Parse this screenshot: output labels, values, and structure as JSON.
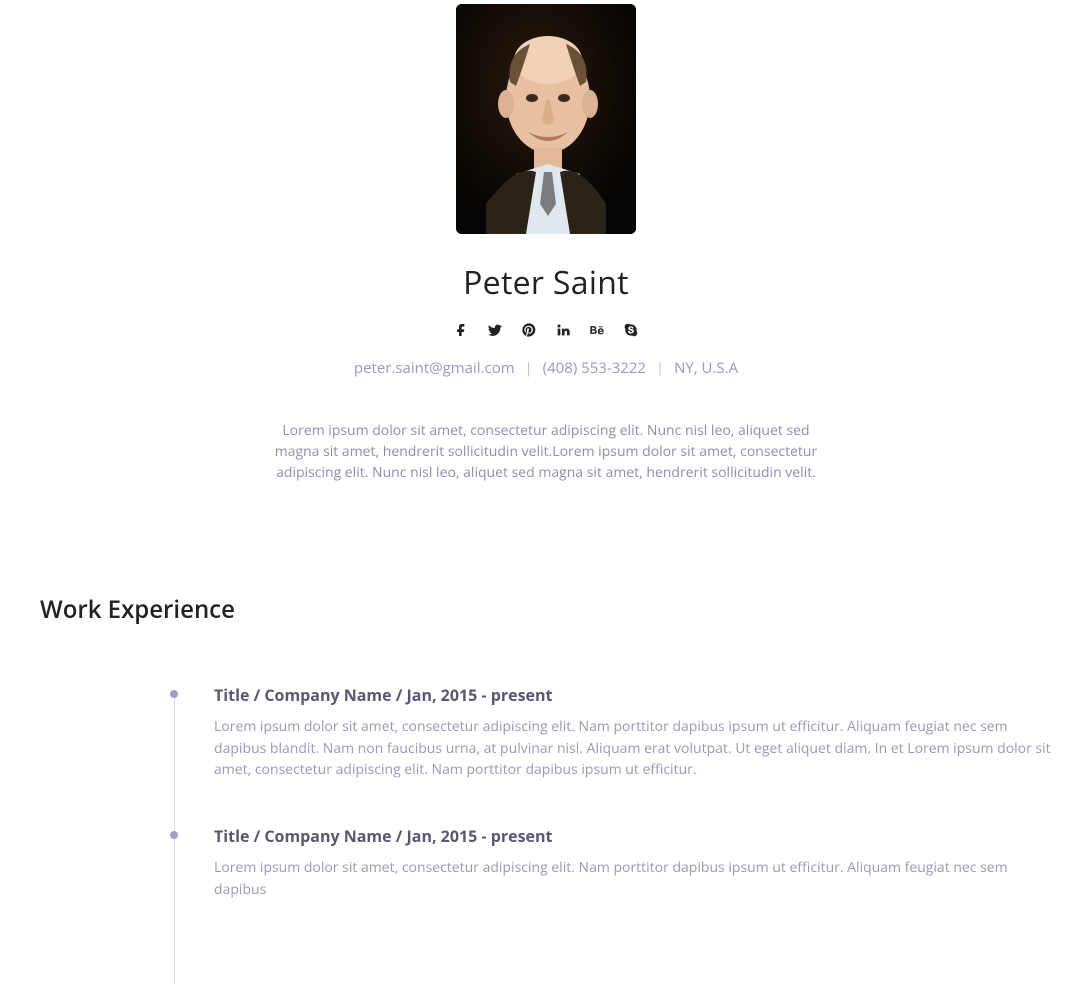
{
  "header": {
    "name": "Peter Saint",
    "email": "peter.saint@gmail.com",
    "phone": "(408) 553-3222",
    "location": "NY, U.S.A",
    "bio": "Lorem ipsum dolor sit amet, consectetur adipiscing elit. Nunc nisl leo, aliquet sed magna sit amet, hendrerit sollicitudin velit.Lorem ipsum dolor sit amet, consectetur adipiscing elit. Nunc nisl leo, aliquet sed magna sit amet, hendrerit sollicitudin velit.",
    "socials": {
      "facebook": "facebook",
      "twitter": "twitter",
      "pinterest": "pinterest",
      "linkedin": "linkedin",
      "behance": "behance",
      "skype": "skype"
    }
  },
  "sections": {
    "work_experience": {
      "heading": "Work Experience",
      "items": [
        {
          "title": "Title / Company Name / Jan, 2015 - present",
          "desc": "Lorem ipsum dolor sit amet, consectetur adipiscing elit. Nam porttitor dapibus ipsum ut efficitur. Aliquam feugiat nec sem dapibus blandit. Nam non faucibus urna, at pulvinar nisl. Aliquam erat volutpat. Ut eget aliquet diam. In et Lorem ipsum dolor sit amet, consectetur adipiscing elit. Nam porttitor dapibus ipsum ut efficitur."
        },
        {
          "title": "Title / Company Name / Jan, 2015 - present",
          "desc": "Lorem ipsum dolor sit amet, consectetur adipiscing elit. Nam porttitor dapibus ipsum ut efficitur. Aliquam feugiat nec sem dapibus"
        }
      ]
    }
  }
}
